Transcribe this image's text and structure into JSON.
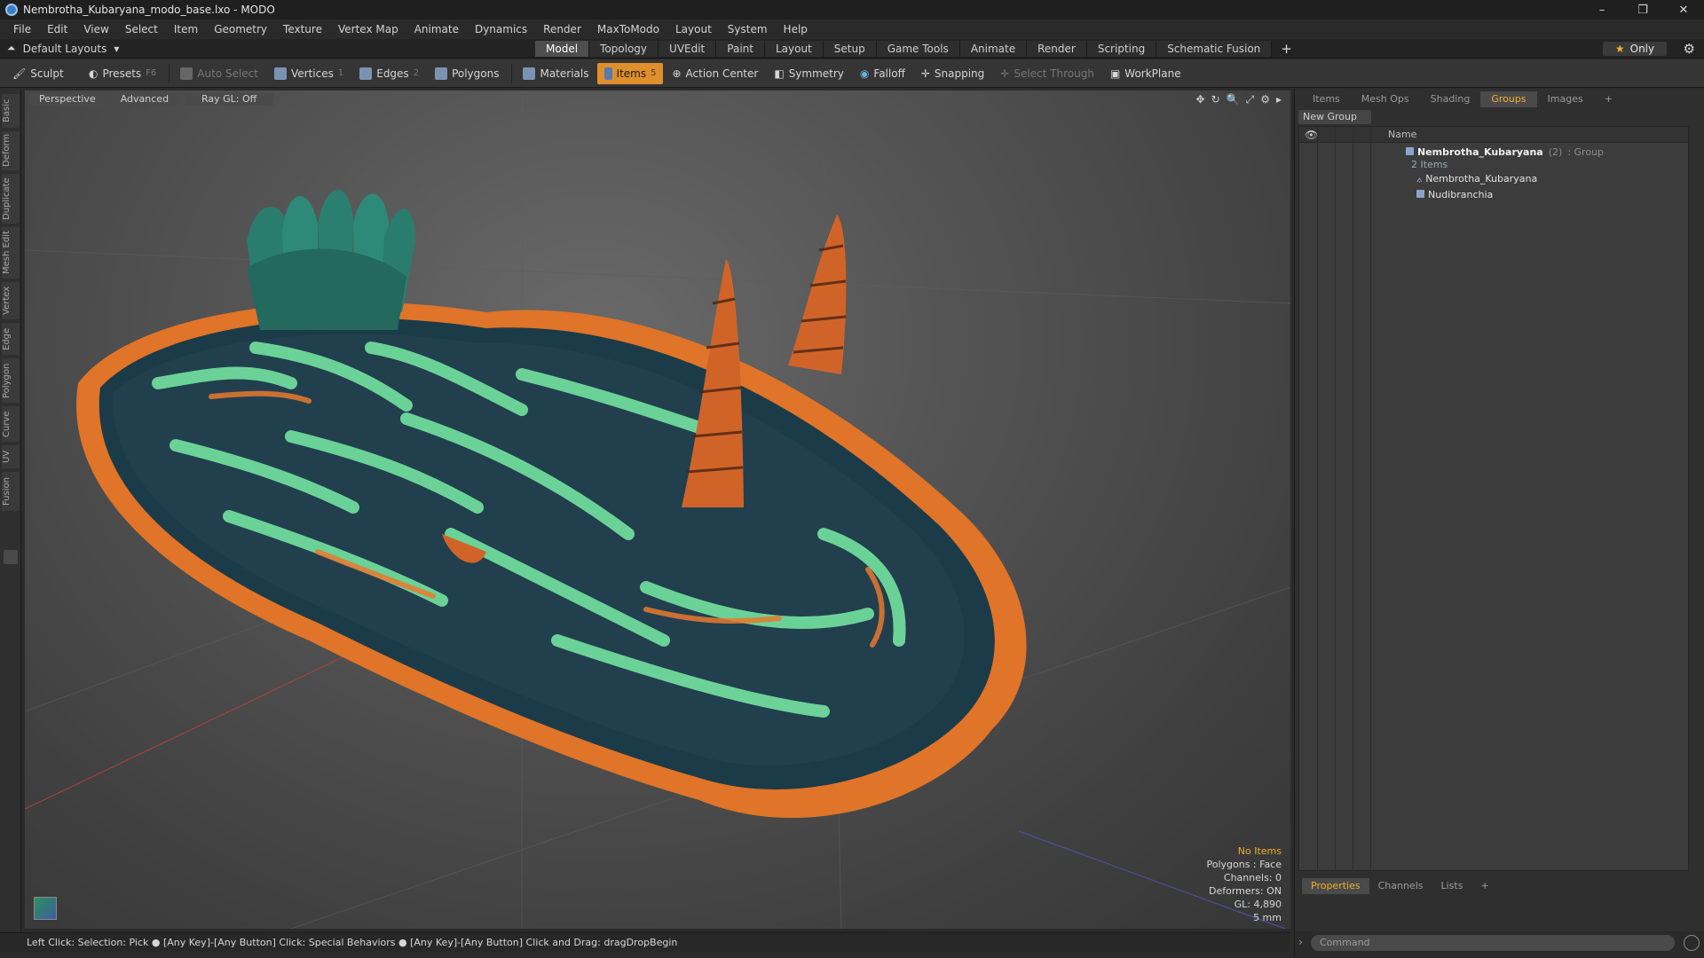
{
  "window": {
    "title": "Nembrotha_Kubaryana_modo_base.lxo - MODO",
    "minimize": "–",
    "restore": "❐",
    "close": "✕"
  },
  "menu": [
    "File",
    "Edit",
    "View",
    "Select",
    "Item",
    "Geometry",
    "Texture",
    "Vertex Map",
    "Animate",
    "Dynamics",
    "Render",
    "MaxToModo",
    "Layout",
    "System",
    "Help"
  ],
  "layout": {
    "preset": "Default Layouts",
    "tabs": [
      "Model",
      "Topology",
      "UVEdit",
      "Paint",
      "Layout",
      "Setup",
      "Game Tools",
      "Animate",
      "Render",
      "Scripting",
      "Schematic Fusion"
    ],
    "active_tab": "Model",
    "only_label": "Only"
  },
  "toolbar": {
    "sculpt": "Sculpt",
    "presets": "Presets",
    "presets_key": "F6",
    "auto_select": "Auto Select",
    "vertices": "Vertices",
    "vertices_key": "1",
    "edges": "Edges",
    "edges_key": "2",
    "polygons": "Polygons",
    "materials": "Materials",
    "items": "Items",
    "items_key": "5",
    "action_center": "Action Center",
    "symmetry": "Symmetry",
    "falloff": "Falloff",
    "snapping": "Snapping",
    "select_through": "Select Through",
    "workplane": "WorkPlane"
  },
  "left_tabs": [
    "Basic",
    "Deform",
    "Duplicate",
    "Mesh Edit",
    "Vertex",
    "Edge",
    "Polygon",
    "Curve",
    "UV",
    "Fusion"
  ],
  "viewport": {
    "view": "Perspective",
    "shading": "Advanced",
    "raygl": "Ray GL: Off",
    "stats": {
      "items": "No Items",
      "polygons": "Polygons : Face",
      "channels": "Channels: 0",
      "deformers": "Deformers: ON",
      "gl": "GL: 4,890",
      "unit": "5 mm"
    }
  },
  "status": "Left Click: Selection: Pick ● [Any Key]-[Any Button] Click: Special Behaviors ● [Any Key]-[Any Button] Click and Drag: dragDropBegin",
  "right_panel": {
    "tabs": [
      "Items",
      "Mesh Ops",
      "Shading",
      "Groups",
      "Images"
    ],
    "active_tab": "Groups",
    "new_group": "New Group",
    "name_header": "Name",
    "group": {
      "name": "Nembrotha_Kubaryana",
      "count": "(2)",
      "type": ": Group",
      "sub": "2 Items"
    },
    "children": [
      "Nembrotha_Kubaryana",
      "Nudibranchia"
    ],
    "bottom_tabs": [
      "Properties",
      "Channels",
      "Lists"
    ],
    "bottom_active": "Properties",
    "command_placeholder": "Command"
  },
  "colors": {
    "accent": "#e08f2d",
    "highlight": "#f0b030"
  }
}
